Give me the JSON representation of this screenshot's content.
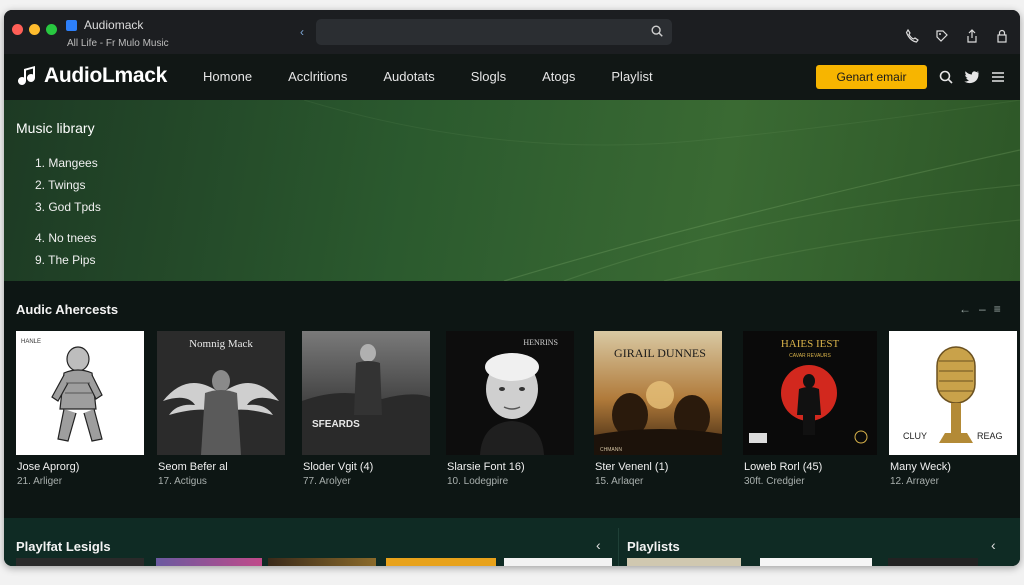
{
  "browser": {
    "tab_title": "Audiomack",
    "tab_subtitle": "All Life - Fr Mulo Music",
    "back_symbol": "‹"
  },
  "nav": {
    "logo_text": "AudioLmack",
    "links": [
      "Homone",
      "Acclritions",
      "Audotats",
      "Slogls",
      "Atogs",
      "Playlist"
    ],
    "cta_label": "Genart emair"
  },
  "hero": {
    "title": "Music library",
    "items": [
      "1. Mangees",
      "2. Twings",
      "3. God Tpds",
      "4. No tnees",
      "9. The Pips"
    ]
  },
  "section": {
    "title": "Audic Ahercests",
    "controls": [
      "←",
      "–",
      "≡"
    ]
  },
  "cards": [
    {
      "title": "Jose Aprorg)",
      "sub": "21. Arliger",
      "cover_text": "HANLE"
    },
    {
      "title": "Seom Befer al",
      "sub": "17. Actigus",
      "cover_text": "Nomnig Mack"
    },
    {
      "title": "Sloder Vgit (4)",
      "sub": "77. Arolyer",
      "cover_text": "SFEARDS"
    },
    {
      "title": "Slarsie Font 16)",
      "sub": "10. Lodegpire",
      "cover_text": "HENRINS"
    },
    {
      "title": "Ster Venenl (1)",
      "sub": "15. Arlaqer",
      "cover_text": "GIRAIL DUNNES"
    },
    {
      "title": "Loweb Rorl (45)",
      "sub": "30ft. Credgier",
      "cover_text": "HAIES IEST"
    },
    {
      "title": "Many Weck)",
      "sub": "12. Arrayer",
      "cover_text_left": "CLUY",
      "cover_text_right": "REAG"
    }
  ],
  "cover_subtext": {
    "c5": "CAVAR REVAURS",
    "c4": "CHMANN"
  },
  "bottom": {
    "left_title": "Playlfat Lesigls",
    "right_title": "Playlists",
    "chevron": "‹"
  },
  "colors": {
    "accent": "#f7b500",
    "hero_green": "#2b5a2e",
    "bottom_teal": "#0f2b24"
  }
}
